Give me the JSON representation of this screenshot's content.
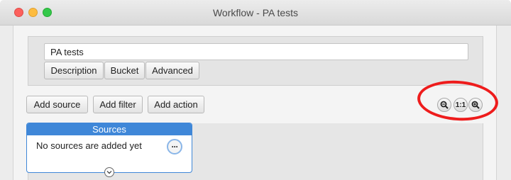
{
  "window": {
    "title": "Workflow - PA tests"
  },
  "form": {
    "name_value": "PA tests",
    "tabs": [
      {
        "label": "Description"
      },
      {
        "label": "Bucket"
      },
      {
        "label": "Advanced"
      }
    ]
  },
  "toolbar": {
    "add_source_label": "Add source",
    "add_filter_label": "Add filter",
    "add_action_label": "Add action",
    "zoom_out_icon": "zoom-out-icon",
    "zoom_reset_label": "1:1",
    "zoom_in_icon": "zoom-in-icon"
  },
  "sources_node": {
    "title": "Sources",
    "message": "No sources are added yet",
    "more_label": "···"
  },
  "colors": {
    "accent": "#3f87d8",
    "highlight": "#ee1c1c",
    "traffic_close": "#fc605c",
    "traffic_min": "#fdbc40",
    "traffic_max": "#34c84a"
  }
}
